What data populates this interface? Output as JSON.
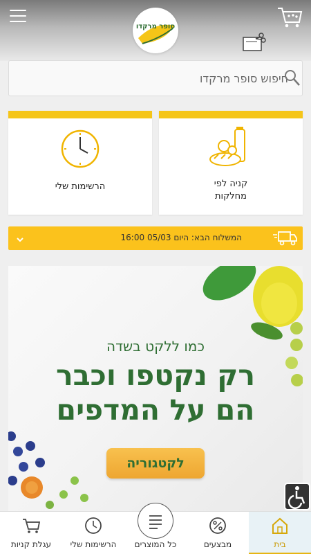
{
  "header": {
    "logo_text": "סופר מרקדו",
    "menu_icon": "hamburger-icon",
    "cart_icon": "cart-icon",
    "clip_icon": "coupon-scissors-icon"
  },
  "search": {
    "placeholder": "חיפוש סופר מרקדו",
    "icon": "search-icon"
  },
  "cards": {
    "lists_label": "הרשימות שלי",
    "categories_label_line1": "קניה לפי",
    "categories_label_line2": "מחלקות"
  },
  "delivery": {
    "text": "המשלוח הבא: היום 05/03 16:00",
    "icon": "truck-icon"
  },
  "banner": {
    "subtitle": "כמו ללקט בשדה",
    "headline_line1": "רק נקטפו וכבר",
    "headline_line2": "הם על המדפים",
    "button_label": "לקטגוריה"
  },
  "colors": {
    "accent_yellow": "#f5c518",
    "brand_green": "#2f6e33",
    "active_nav": "#c99a06"
  },
  "bottom_nav": {
    "home": "בית",
    "deals": "מבצעים",
    "all_products": "כל המוצרים",
    "my_lists": "הרשימות שלי",
    "cart": "עגלת קניות"
  }
}
